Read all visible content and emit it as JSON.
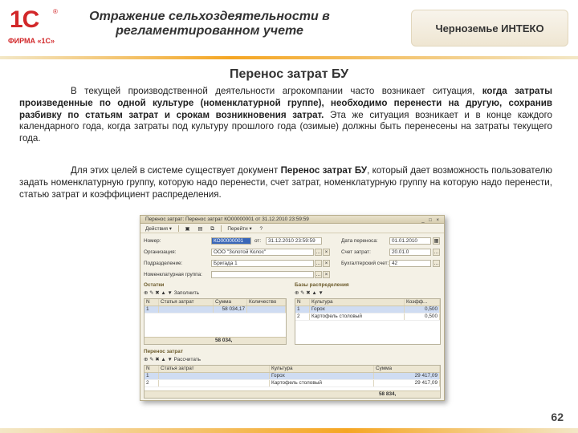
{
  "header": {
    "logo_mark": "1С",
    "logo_firm": "ФИРМА «1С»",
    "title_line1": "Отражение сельхоздеятельности в",
    "title_line2": "регламентированном учете",
    "company": "Черноземье ИНТЕКО"
  },
  "section_title": "Перенос затрат БУ",
  "paragraph1": {
    "part1": "В текущей производственной деятельности агрокомпании часто возникает ситуация, ",
    "bold": "когда затраты произведенные по одной культуре (номенклатурной группе), необходимо перенести на другую, сохранив разбивку по статьям затрат и срокам возникновения затрат.",
    "part2": " Эта же ситуация возникает и в конце каждого календарного года, когда затраты под культуру прошлого года (озимые) должны быть перенесены на затраты текущего года."
  },
  "paragraph2": {
    "part1": "Для этих целей в системе существует документ ",
    "bold": "Перенос затрат БУ",
    "part2": ", который дает возможность пользователю задать номенклатурную группу, которую надо перенести, счет затрат, номенклатурную группу на которую надо перенести, статью затрат и коэффициент распределения."
  },
  "window": {
    "title": "Перенос затрат: Перенос затрат КО00000001 от 31.12.2010 23:59:59",
    "controls": "_ □ ×",
    "toolbar": [
      "Действия ▾",
      "Перейти ▾",
      "?"
    ],
    "fields": {
      "nomer_label": "Номер:",
      "nomer_value": "КО00000001",
      "ot_label": "от:",
      "ot_value": "31.12.2010 23:59:59",
      "org_label": "Организация:",
      "org_value": "ООО \"Золотой Колос\"",
      "podr_label": "Подразделение:",
      "podr_value": "Бригада 1",
      "nomgr_label": "Номенклатурная группа:",
      "data_label": "Дата переноса:",
      "data_value": "01.01.2010",
      "schet_label": "Счет затрат:",
      "schet_value": "20.01.0",
      "buh_label": "Бухгалтерский счет:",
      "buh_value": "42"
    },
    "ostatki": {
      "title": "Остатки",
      "toolbar_label": "Заполнить",
      "columns": [
        "N",
        "Статья затрат",
        "Сумма",
        "Количество"
      ],
      "rows": [
        {
          "n": "1",
          "statya": "",
          "summa": "58 034,17",
          "kol": ""
        }
      ],
      "total": "58 034,"
    },
    "bazy": {
      "title": "Базы распределения",
      "columns": [
        "N",
        "Культура",
        "Коэфф..."
      ],
      "rows": [
        {
          "n": "1",
          "kultura": "Горох",
          "koef": "0,500"
        },
        {
          "n": "2",
          "kultura": "Картофель столовый",
          "koef": "0,500"
        }
      ]
    },
    "perenos": {
      "title": "Перенос затрат",
      "toolbar_label": "Рассчитать",
      "columns": [
        "N",
        "Статья затрат",
        "Культура",
        "Сумма"
      ],
      "rows": [
        {
          "n": "1",
          "statya": "",
          "kultura": "Горох",
          "summa": "29 417,09"
        },
        {
          "n": "2",
          "statya": "",
          "kultura": "Картофель столовый",
          "summa": "29 417,09"
        }
      ],
      "total": "58 834,"
    }
  },
  "page_number": "62"
}
